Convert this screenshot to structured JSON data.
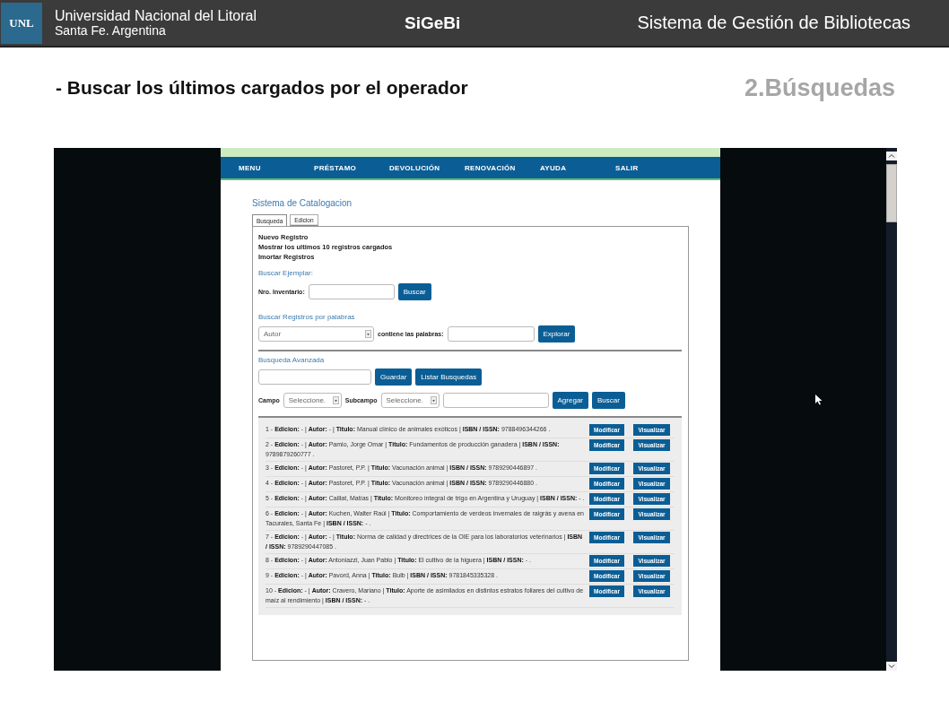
{
  "header": {
    "institution": "Universidad Nacional del Litoral",
    "location": "Santa Fe. Argentina",
    "logo": "UNL",
    "app_name": "SiGeBi",
    "system_title": "Sistema de Gestión de Bibliotecas"
  },
  "slide_heading": "- Buscar los últimos cargados por el operador",
  "section_label": "2.Búsquedas",
  "nav": [
    "MENU",
    "PRÉSTAMO",
    "DEVOLUCIÓN",
    "RENOVACIÓN",
    "AYUDA",
    "SALIR"
  ],
  "page_title": "Sistema de Catalogacion",
  "tabs": [
    {
      "label": "Busqueda",
      "selected": true
    },
    {
      "label": "Edicion",
      "selected": false
    }
  ],
  "links": [
    "Nuevo Registro",
    "Mostrar los ultimos 10 registros cargados",
    "Imortar Registros"
  ],
  "buscar_ejemplar": {
    "title": "Buscar Ejemplar:",
    "label": "Nro. Inventario:",
    "button": "Buscar"
  },
  "buscar_palabras": {
    "title": "Buscar Registros por palabras",
    "select": "Autor",
    "label": "contiene las palabras:",
    "button": "Explorar"
  },
  "avanzada": {
    "title": "Busqueda Avanzada",
    "buttons": [
      "Guardar",
      "Listar Busquedas"
    ],
    "campo_label": "Campo",
    "campo_select": "Seleccione.",
    "subcampo_label": "Subcampo",
    "subcampo_select": "Seleccione.",
    "actions": [
      "Agregar",
      "Buscar"
    ]
  },
  "records": [
    {
      "text": "1 - **Edicion:** - | **Autor:** - | **Titulo:** Manual clínico de animales exóticos | **ISBN / ISSN:** 9788496344266 .",
      "buttons": [
        "Modificar",
        "Visualizar"
      ]
    },
    {
      "text": "2 - **Edicion:** - | **Autor:** Pamio, Jorge Omar | **Titulo:** Fundamentos de producción ganadera | **ISBN / ISSN:** 9789879260777 .",
      "buttons": [
        "Modificar",
        "Visualizar"
      ]
    },
    {
      "text": "3 - **Edicion:** - | **Autor:** Pastoret, P.P. | **Titulo:** Vacunación animal | **ISBN / ISSN:** 9789290446897 .",
      "buttons": [
        "Modificar",
        "Visualizar"
      ]
    },
    {
      "text": "4 - **Edicion:** - | **Autor:** Pastoret, P.P. | **Titulo:** Vacunación animal | **ISBN / ISSN:** 9789290446880 .",
      "buttons": [
        "Modificar",
        "Visualizar"
      ]
    },
    {
      "text": "5 - **Edicion:** - | **Autor:** Caillat, Matías | **Titulo:** Monitoreo integral de trigo en Argentina y Uruguay | **ISBN / ISSN:** - .",
      "buttons": [
        "Modificar",
        "Visualizar"
      ]
    },
    {
      "text": "6 - **Edicion:** - | **Autor:** Kuchen, Walter Raúl | **Titulo:** Comportamiento de verdeos invernales de raigrás y avena en Tacurales, Santa Fe | **ISBN / ISSN:** - .",
      "buttons": [
        "Modificar",
        "Visualizar"
      ]
    },
    {
      "text": "7 - **Edicion:** - | **Autor:** - | **Titulo:** Norma de calidad y directrices de la OIE para los laboratorios veterinarios | **ISBN / ISSN:** 9789290447085 .",
      "buttons": [
        "Modificar",
        "Visualizar"
      ]
    },
    {
      "text": "8 - **Edicion:** - | **Autor:** Antoniazzi, Juan Pablo | **Titulo:** El cultivo de la higuera | **ISBN / ISSN:** - .",
      "buttons": [
        "Modificar",
        "Visualizar"
      ]
    },
    {
      "text": "9 - **Edicion:** - | **Autor:** Pavord, Anna | **Titulo:** Bulb | **ISBN / ISSN:** 9781845335328 .",
      "buttons": [
        "Modificar",
        "Visualizar"
      ]
    },
    {
      "text": "10 - **Edicion:** - | **Autor:** Cravero, Mariano | **Titulo:** Aporte de asimilados en distintos estratos foliares del cultivo de maíz al rendimiento | **ISBN / ISSN:** - .",
      "buttons": [
        "Modificar",
        "Visualizar"
      ]
    }
  ]
}
